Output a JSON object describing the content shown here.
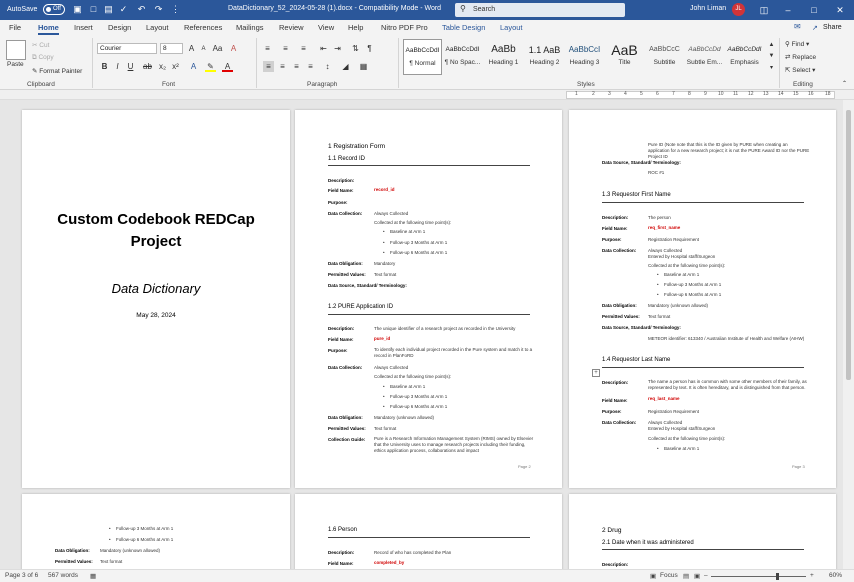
{
  "titlebar": {
    "autosave": "AutoSave",
    "autosave_state": "Off",
    "title": "DataDictionary_52_2024-05-28 (1).docx  -  Compatibility Mode  -  Word",
    "search_placeholder": "Search",
    "user": "John Liman",
    "initials": "JL"
  },
  "tabs": [
    "File",
    "Home",
    "Insert",
    "Design",
    "Layout",
    "References",
    "Mailings",
    "Review",
    "View",
    "Help",
    "Nitro PDF Pro",
    "Table Design",
    "Layout"
  ],
  "share": "Share",
  "ribbon": {
    "clipboard": {
      "paste": "Paste",
      "cut": "Cut",
      "copy": "Copy",
      "format_painter": "Format Painter",
      "label": "Clipboard"
    },
    "font": {
      "name": "Courier",
      "size": "8",
      "label": "Font",
      "bold": "B",
      "italic": "I",
      "underline": "U"
    },
    "paragraph": {
      "label": "Paragraph"
    },
    "styles": {
      "label": "Styles",
      "items": [
        {
          "preview": "AaBbCcDdI",
          "name": "¶ Normal"
        },
        {
          "preview": "AaBbCcDdI",
          "name": "¶ No Spac..."
        },
        {
          "preview": "AaBb",
          "name": "Heading 1"
        },
        {
          "preview": "1.1  AaB",
          "name": "Heading 2"
        },
        {
          "preview": "AaBbCcI",
          "name": "Heading 3"
        },
        {
          "preview": "AaB",
          "name": "Title"
        },
        {
          "preview": "AaBbCcC",
          "name": "Subtitle"
        },
        {
          "preview": "AaBbCcDd",
          "name": "Subtle Em..."
        },
        {
          "preview": "AaBbCcDdI",
          "name": "Emphasis"
        }
      ]
    },
    "editing": {
      "find": "Find",
      "replace": "Replace",
      "select": "Select",
      "label": "Editing"
    }
  },
  "ruler": {
    "nums": [
      "1",
      "2",
      "3",
      "4",
      "5",
      "6",
      "7",
      "8",
      "9",
      "10",
      "11",
      "12",
      "13",
      "14",
      "15",
      "16",
      "18"
    ]
  },
  "doc": {
    "cover": {
      "title": "Custom Codebook REDCap Project",
      "subtitle": "Data Dictionary",
      "date": "May 28, 2024"
    },
    "p2": {
      "s1": "1        Registration Form",
      "s11": "1.1       Record ID",
      "description": "Description:",
      "field_name": "Field Name:",
      "purpose": "Purpose:",
      "data_collection": "Data Collection:",
      "data_obligation": "Data Obligation:",
      "permitted_values": "Permitted Values:",
      "data_source": "Data Source, Standard/ Terminology:",
      "collection_guide": "Collection Guide:",
      "record_field": "record_id",
      "always_collected": "Always Collected",
      "collected_at": "Collected at the following time point(s):",
      "b1": "Baseline at Arm 1",
      "b2": "Follow-up 3 Months at Arm 1",
      "b3": "Follow-up 6 Months at Arm 1",
      "mandatory": "Mandatory",
      "text_format": "Text format",
      "s12": "1.2       PURE Application ID",
      "pure_desc": "The unique identifier of a research project as recorded in the University",
      "pure_field": "pure_id",
      "pure_purpose": "To identify each individual project recorded in the Pure system and match it to a record in PlanFoRD",
      "mand_unknown": "Mandatory (unknown allowed)",
      "guide": "Pure is a Research Information Management System (RIMS) owned by Elsevier that the University uses to manage research projects including their funding, ethics application process, collaborations and impact",
      "page": "Page 2"
    },
    "p3": {
      "intro": "Pure ID (Note note that this is the ID given by PURE when creating an application for a new research project; it is not the PURE Award ID nor the PURE Project ID",
      "roc": "ROC #1",
      "s13": "1.3       Requestor First Name",
      "fn_desc": "The person",
      "fn_field": "req_first_name",
      "purpose_val": "Registration Requirement",
      "ent_hosp": "Entered by Hospital staff/Surgeon",
      "meteor": "METEOR identifier: 613340 / Australian Institute of Health and Welfare (AIHW)",
      "s14": "1.4       Requestor Last Name",
      "ln_desc": "The name a person has in common with some other members of their family, as represented by text. It is often hereditary, and is distinguished from that person.",
      "ln_field": "req_last_name",
      "page": "Page 3"
    },
    "p4": {
      "s16": "1.6       Person",
      "desc": "Record of who has completed the Plan",
      "field": "completed_by"
    },
    "p6": {
      "s2": "2        Drug",
      "s21": "2.1       Date when it was administered"
    }
  },
  "status": {
    "page": "Page 3 of 6",
    "words": "567 words",
    "focus": "Focus",
    "zoom": "60%"
  }
}
